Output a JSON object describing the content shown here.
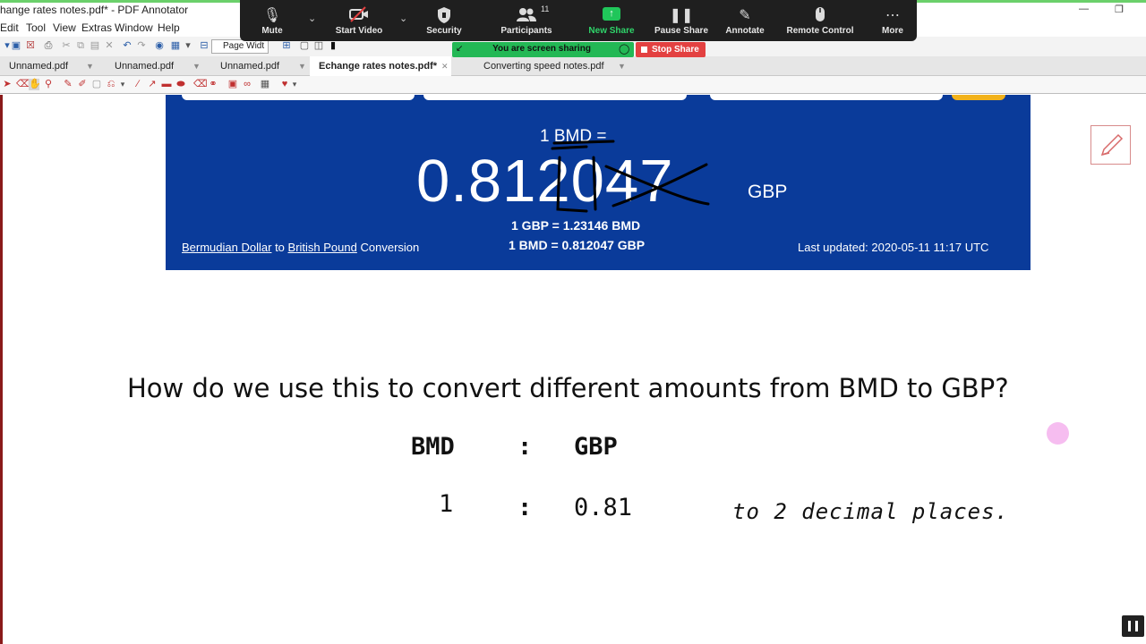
{
  "window": {
    "title": "hange rates notes.pdf* - PDF Annotator",
    "minimize_icon": "minimize-icon",
    "restore_icon": "restore-icon"
  },
  "menu": {
    "items": [
      "Edit",
      "Tool",
      "View",
      "Extras",
      "Window",
      "Help"
    ]
  },
  "toolbar": {
    "zoom_value": "Page Widt"
  },
  "tabs": [
    {
      "label": "Unnamed.pdf",
      "active": false
    },
    {
      "label": "Unnamed.pdf",
      "active": false
    },
    {
      "label": "Unnamed.pdf",
      "active": false
    },
    {
      "label": "Echange rates notes.pdf*",
      "active": true
    },
    {
      "label": "Converting speed notes.pdf",
      "active": false
    }
  ],
  "meeting": {
    "buttons": [
      {
        "label": "Mute",
        "icon": "microphone-icon"
      },
      {
        "label": "Start Video",
        "icon": "video-off-icon"
      },
      {
        "label": "Security",
        "icon": "shield-icon"
      },
      {
        "label": "Participants",
        "icon": "participants-icon"
      },
      {
        "label": "New Share",
        "icon": "share-arrow-icon"
      },
      {
        "label": "Pause Share",
        "icon": "pause-icon"
      },
      {
        "label": "Annotate",
        "icon": "pencil-icon"
      },
      {
        "label": "Remote Control",
        "icon": "mouse-icon"
      },
      {
        "label": "More",
        "icon": "ellipsis-icon"
      }
    ],
    "participants_count": "11",
    "sharing_banner": "You are screen sharing",
    "stop_share_label": "Stop Share",
    "colors": {
      "bar": "#1f1f1f",
      "share_green": "#23b855",
      "stop_red": "#e34141"
    }
  },
  "document": {
    "rate_card": {
      "prefix": "1 BMD =",
      "rate": "0.812047",
      "unit": "GBP",
      "inverse": "1 GBP = 1.23146 BMD",
      "direct": "1 BMD = 0.812047 GBP",
      "link_from": "Bermudian Dollar",
      "link_joiner": "to",
      "link_to": "British Pound",
      "link_suffix": "Conversion",
      "last_updated": "Last updated: 2020-05-11 11:17 UTC",
      "background": "#0a3b9a"
    },
    "question": "How do we use this to convert different amounts from BMD to GBP?",
    "handwriting": {
      "col1": "BMD",
      "separator": ":",
      "col2": "GBP",
      "row_left": "1",
      "row_right": "0.81",
      "note": "to 2 decimal places."
    }
  }
}
